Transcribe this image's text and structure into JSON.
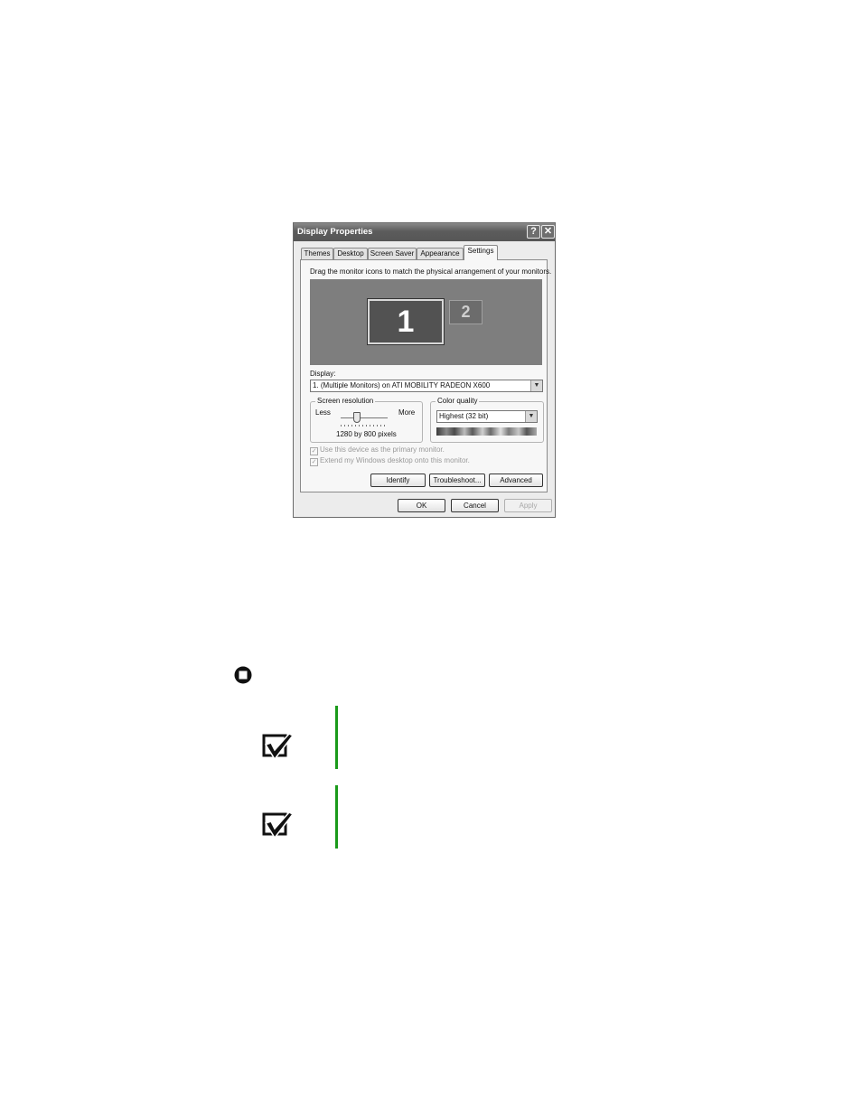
{
  "dialog": {
    "title": "Display Properties",
    "help_glyph": "?",
    "close_glyph": "✕",
    "tabs": [
      {
        "label": "Themes"
      },
      {
        "label": "Desktop"
      },
      {
        "label": "Screen Saver"
      },
      {
        "label": "Appearance"
      },
      {
        "label": "Settings"
      }
    ],
    "active_tab": "Settings",
    "instruction": "Drag the monitor icons to match the physical arrangement of your monitors.",
    "monitors": {
      "primary": "1",
      "secondary": "2"
    },
    "display_label": "Display:",
    "display_value": "1. (Multiple Monitors) on ATI MOBILITY RADEON X600",
    "resolution": {
      "group_label": "Screen resolution",
      "less": "Less",
      "more": "More",
      "value": "1280 by 800 pixels",
      "slider_fraction": 0.38
    },
    "color_quality": {
      "group_label": "Color quality",
      "value": "Highest (32 bit)"
    },
    "checkboxes": [
      {
        "label": "Use this device as the primary monitor.",
        "checked": true,
        "enabled": false
      },
      {
        "label": "Extend my Windows desktop onto this monitor.",
        "checked": true,
        "enabled": false
      }
    ],
    "buttons": {
      "identify": "Identify",
      "troubleshoot": "Troubleshoot...",
      "advanced": "Advanced",
      "ok": "OK",
      "cancel": "Cancel",
      "apply": "Apply"
    }
  },
  "icons": {
    "stop": "stop-icon",
    "note": "checkmark-note-icon",
    "note_rule_color": "#1a9a1a"
  }
}
